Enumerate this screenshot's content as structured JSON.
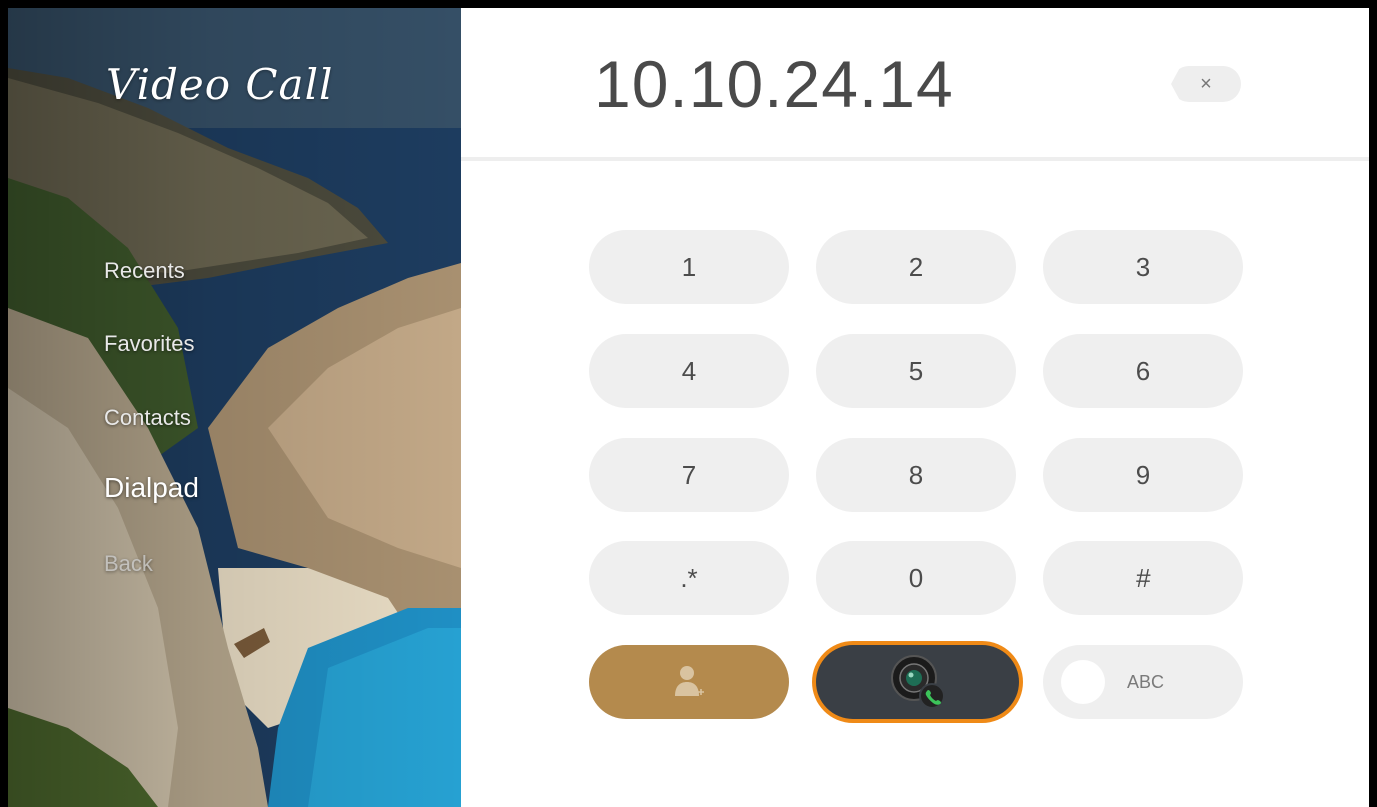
{
  "app": {
    "title": "Video Call"
  },
  "nav": {
    "recents": "Recents",
    "favorites": "Favorites",
    "contacts": "Contacts",
    "dialpad": "Dialpad",
    "back": "Back"
  },
  "dialer": {
    "number": "10.10.24.14",
    "clear_symbol": "×"
  },
  "keypad": {
    "k1": "1",
    "k2": "2",
    "k3": "3",
    "k4": "4",
    "k5": "5",
    "k6": "6",
    "k7": "7",
    "k8": "8",
    "k9": "9",
    "kstar": ".*",
    "k0": "0",
    "khash": "#"
  },
  "actions": {
    "add_contact_icon": "person-plus-icon",
    "call_icon": "video-camera-phone-icon",
    "abc_label": "ABC"
  },
  "colors": {
    "contact_button": "#b48a4d",
    "call_button": "#3a3f45",
    "call_focus_ring": "#ef8a17",
    "key_bg": "#efefef"
  }
}
